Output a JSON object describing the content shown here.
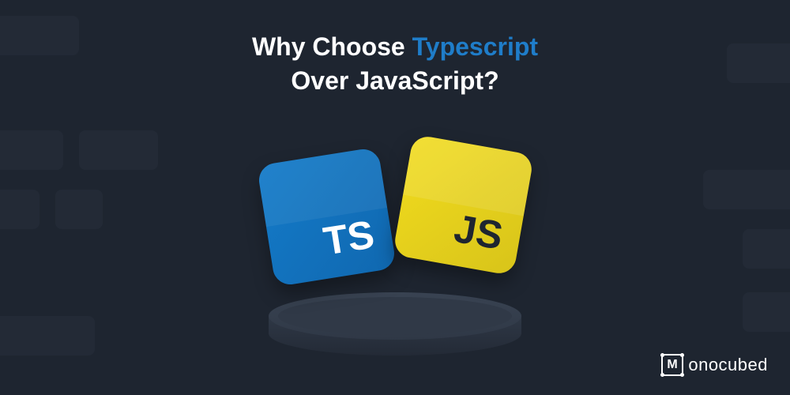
{
  "heading": {
    "line1_prefix": "Why Choose ",
    "line1_highlight": "Typescript",
    "line2_prefix": "Over ",
    "line2_highlight": "JavaScript",
    "line2_suffix": "?"
  },
  "cards": {
    "ts_label": "TS",
    "js_label": "JS"
  },
  "brand": {
    "icon_letter": "M",
    "name_suffix": "onocubed"
  },
  "colors": {
    "background": "#1e2530",
    "accent_blue": "#1f7dc9",
    "ts_card": "#147bc9",
    "js_card": "#f2dc1e",
    "text": "#ffffff"
  }
}
